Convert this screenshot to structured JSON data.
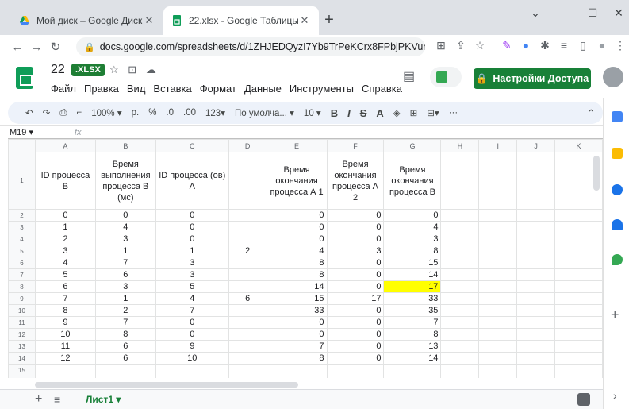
{
  "browser": {
    "tabs": [
      {
        "title": "Мой диск – Google Диск",
        "active": false,
        "icon": "drive-icon"
      },
      {
        "title": "22.xlsx - Google Таблицы",
        "active": true,
        "icon": "sheets-icon"
      }
    ],
    "url": "docs.google.com/spreadsheets/d/1ZHJEDQyzI7Yb9TrPeKCrx8FPbjPKVunl/edit#gid..."
  },
  "doc": {
    "title": "22",
    "badge": ".XLSX",
    "menus": [
      "Файл",
      "Правка",
      "Вид",
      "Вставка",
      "Формат",
      "Данные",
      "Инструменты",
      "Справка"
    ],
    "share_label": "Настройки Доступа"
  },
  "toolbar": {
    "zoom": "100%",
    "currency": "р.",
    "percent": "%",
    "dec_minus": ".0",
    "dec_plus": ".00",
    "format": "123",
    "font": "По умолча...",
    "font_size": "10",
    "bold": "B",
    "italic": "I",
    "strike": "S",
    "text_color": "A",
    "more": "···"
  },
  "formula": {
    "cell_ref": "M19",
    "fx": "fx"
  },
  "sheet": {
    "columns": [
      "A",
      "B",
      "C",
      "D",
      "E",
      "F",
      "G",
      "H",
      "I",
      "J",
      "K"
    ],
    "headers": [
      "ID процесса B",
      "Время выполнения процесса B (мс)",
      "ID процесса (ов) A",
      "",
      "Время окончания процесса А 1",
      "Время окончания процесса А 2",
      "Время окончания процесса B",
      "",
      "",
      "",
      ""
    ],
    "rows": [
      {
        "num": "2",
        "cells": [
          "0",
          "0",
          "0",
          "",
          "0",
          "0",
          "0"
        ]
      },
      {
        "num": "3",
        "cells": [
          "1",
          "4",
          "0",
          "",
          "0",
          "0",
          "4"
        ]
      },
      {
        "num": "4",
        "cells": [
          "2",
          "3",
          "0",
          "",
          "0",
          "0",
          "3"
        ]
      },
      {
        "num": "5",
        "cells": [
          "3",
          "1",
          "1",
          "2",
          "4",
          "3",
          "8"
        ]
      },
      {
        "num": "6",
        "cells": [
          "4",
          "7",
          "3",
          "",
          "8",
          "0",
          "15"
        ]
      },
      {
        "num": "7",
        "cells": [
          "5",
          "6",
          "3",
          "",
          "8",
          "0",
          "14"
        ]
      },
      {
        "num": "8",
        "cells": [
          "6",
          "3",
          "5",
          "",
          "14",
          "0",
          "17"
        ]
      },
      {
        "num": "9",
        "cells": [
          "7",
          "1",
          "4",
          "6",
          "15",
          "17",
          "33"
        ]
      },
      {
        "num": "10",
        "cells": [
          "8",
          "2",
          "7",
          "",
          "33",
          "0",
          "35"
        ]
      },
      {
        "num": "11",
        "cells": [
          "9",
          "7",
          "0",
          "",
          "0",
          "0",
          "7"
        ]
      },
      {
        "num": "12",
        "cells": [
          "10",
          "8",
          "0",
          "",
          "0",
          "0",
          "8"
        ]
      },
      {
        "num": "13",
        "cells": [
          "11",
          "6",
          "9",
          "",
          "7",
          "0",
          "13"
        ]
      },
      {
        "num": "14",
        "cells": [
          "12",
          "6",
          "10",
          "",
          "8",
          "0",
          "14"
        ]
      },
      {
        "num": "15",
        "cells": [
          "",
          "",
          "",
          "",
          "",
          "",
          ""
        ]
      },
      {
        "num": "16",
        "cells": [
          "",
          "",
          "",
          "",
          "",
          "",
          ""
        ]
      }
    ],
    "highlight_color": "#ffff00"
  },
  "sheettab": {
    "label": "Лист1"
  },
  "colors": {
    "accent": "#188038",
    "highlight": "#ffff00"
  }
}
